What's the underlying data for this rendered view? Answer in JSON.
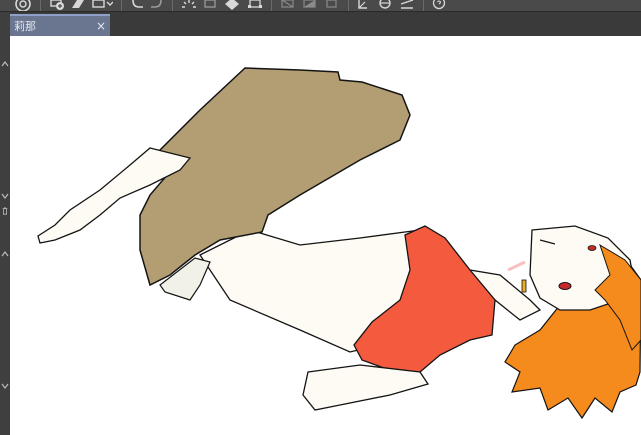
{
  "window": {
    "tab": {
      "label": "莉那",
      "close_glyph": "×"
    }
  },
  "toolbar": {
    "icons": [
      "app-menu-icon",
      "new-layer-icon",
      "layer-property-icon",
      "fill-icon",
      "undo-icon",
      "redo-icon",
      "loading-icon",
      "clear-icon",
      "fill-selection-icon",
      "transform-icon",
      "deselect-icon",
      "invert-selection-icon",
      "select-layer-icon",
      "ruler-icon",
      "rotate-icon",
      "flip-icon",
      "help-icon"
    ]
  },
  "canvas": {
    "content": "illustration",
    "colors": {
      "background": "#ffffff",
      "skin": "#fdfbf4",
      "pants": "#b39d72",
      "shirt": "#f35a3e",
      "hair": "#f58a1d",
      "lines": "#141414"
    }
  },
  "colors": {
    "tab_active": "#6a7590",
    "chrome": "#3a3a3a"
  }
}
